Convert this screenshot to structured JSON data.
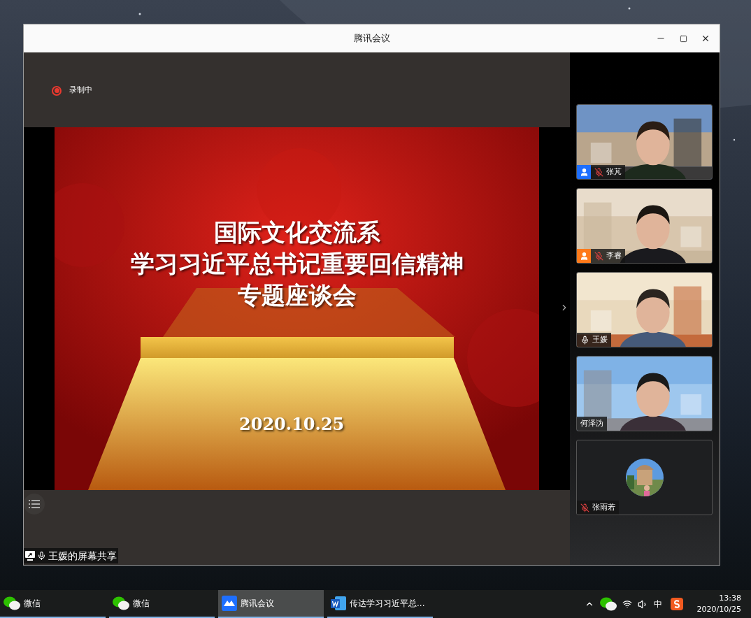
{
  "window": {
    "title": "腾讯会议"
  },
  "recording": {
    "label": "录制中",
    "on": true
  },
  "slide": {
    "lines": [
      "国际文化交流系",
      "学习习近平总书记重要回信精神",
      "专题座谈会"
    ],
    "date": "2020.10.25"
  },
  "share_label": "王媛的屏幕共享",
  "participants": [
    {
      "name": "张芃",
      "kind": "video",
      "muted": true,
      "color": "#1e6fff"
    },
    {
      "name": "李睿",
      "kind": "video",
      "muted": true,
      "color": "#ff7a1a"
    },
    {
      "name": "王媛",
      "kind": "video",
      "muted": false
    },
    {
      "name": "何泽沩",
      "kind": "video"
    },
    {
      "name": "张雨若",
      "kind": "avatar",
      "muted": true
    }
  ],
  "taskbar": {
    "items": [
      {
        "label": "微信",
        "kind": "wechat",
        "selected": false
      },
      {
        "label": "微信",
        "kind": "wechat",
        "selected": false
      },
      {
        "label": "腾讯会议",
        "kind": "meeting",
        "selected": true
      },
      {
        "label": "传达学习习近平总...",
        "kind": "word",
        "selected": false
      }
    ],
    "input_method": "中",
    "time": "13:38",
    "date": "2020/10/25"
  }
}
